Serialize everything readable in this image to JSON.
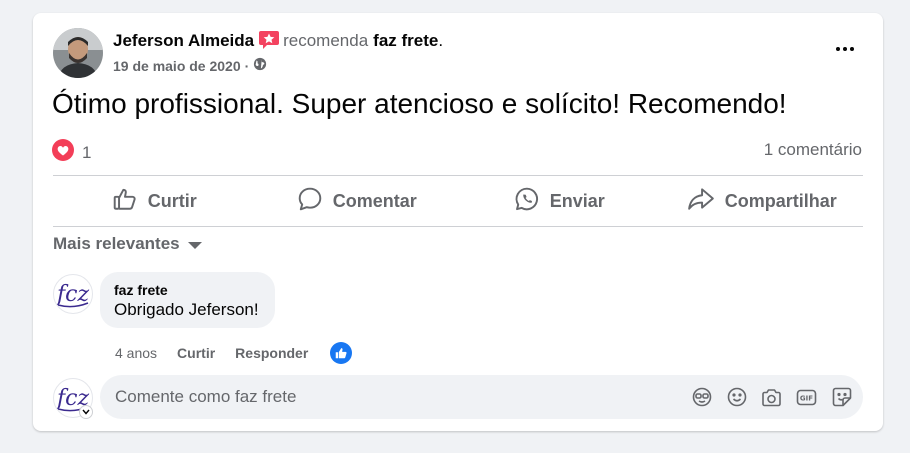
{
  "post": {
    "author": "Jeferson Almeida",
    "recommend_text": "recomenda",
    "page_name": "faz frete",
    "page_suffix": ".",
    "date": "19 de maio de 2020",
    "separator": "·",
    "privacy_icon": "globe-icon",
    "text": "Ótimo profissional. Super atencioso e solícito! Recomendo!",
    "reaction_count": "1",
    "comment_count": "1 comentário"
  },
  "actions": {
    "like": "Curtir",
    "comment": "Comentar",
    "send": "Enviar",
    "share": "Compartilhar"
  },
  "comments_section": {
    "sort_label": "Mais relevantes",
    "comments": [
      {
        "author": "faz frete",
        "text": "Obrigado Jeferson!",
        "age": "4 anos",
        "like_label": "Curtir",
        "reply_label": "Responder"
      }
    ],
    "input_placeholder": "Comente como faz frete",
    "input_icons": [
      "avatar-sticker-icon",
      "emoji-icon",
      "camera-icon",
      "gif-icon",
      "sticker-icon"
    ]
  },
  "colors": {
    "accent_blue": "#1877f2",
    "love_red": "#f33e58",
    "recommend_pink": "#f3425f",
    "secondary_text": "#65676b",
    "logo_purple": "#3b2a8f"
  }
}
